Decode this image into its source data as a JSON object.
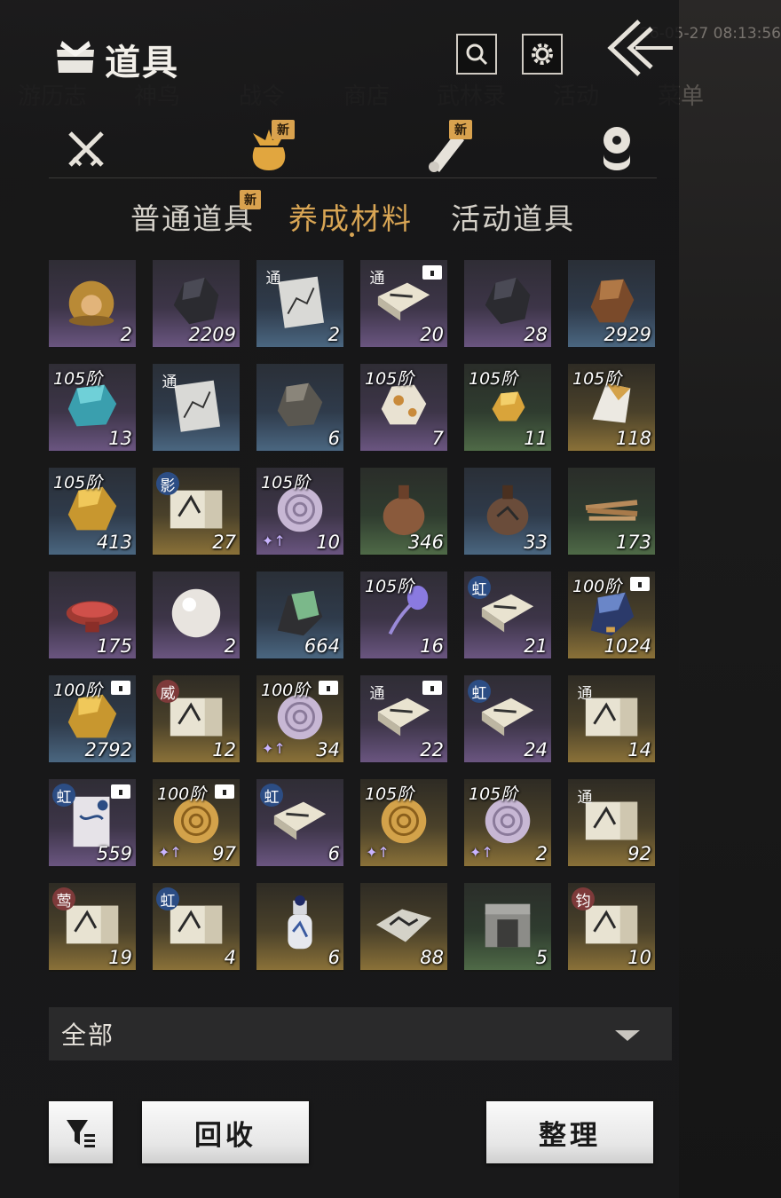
{
  "background": {
    "nav_labels": [
      "游历志",
      "神鸟",
      "战令",
      "商店",
      "武林录",
      "活动",
      "菜单"
    ],
    "clock": "26-05-27 08:13:56"
  },
  "header": {
    "title": "道具",
    "title_icon": "bundle-icon",
    "search_icon": "search-icon",
    "settings_icon": "gear-icon",
    "back_icon": "back-chevron-icon"
  },
  "category_tabs": [
    {
      "icon": "crossed-swords-icon",
      "badge": ""
    },
    {
      "icon": "pouch-icon",
      "badge": "新",
      "active": true
    },
    {
      "icon": "scroll-icon",
      "badge": "新"
    },
    {
      "icon": "stacked-coins-icon",
      "badge": ""
    }
  ],
  "sub_tabs": [
    {
      "label": "普通道具",
      "badge": "新"
    },
    {
      "label": "养成材料",
      "active": true
    },
    {
      "label": "活动道具"
    }
  ],
  "items": [
    {
      "art": "golden-orb",
      "rarity": "purple",
      "count": "2"
    },
    {
      "art": "dark-ore",
      "rarity": "purple",
      "count": "2209"
    },
    {
      "art": "chart-manual",
      "rarity": "blue",
      "count": "2",
      "tag": "通"
    },
    {
      "art": "manual-book",
      "rarity": "purple",
      "count": "20",
      "tag": "通",
      "lock": true
    },
    {
      "art": "dark-ore",
      "rarity": "purple",
      "count": "28"
    },
    {
      "art": "copper-ore",
      "rarity": "blue",
      "count": "2929"
    },
    {
      "art": "turquoise-ore",
      "rarity": "purple",
      "count": "13",
      "tier": "105阶"
    },
    {
      "art": "chart-manual",
      "rarity": "blue",
      "count": "",
      "tag": "通"
    },
    {
      "art": "grey-ore",
      "rarity": "blue",
      "count": "6"
    },
    {
      "art": "white-gold-ore",
      "rarity": "purple",
      "count": "7",
      "tier": "105阶"
    },
    {
      "art": "gold-nugget",
      "rarity": "green",
      "count": "11",
      "tier": "105阶"
    },
    {
      "art": "white-crystal",
      "rarity": "gold",
      "count": "118",
      "tier": "105阶"
    },
    {
      "art": "gold-nugget-large",
      "rarity": "blue",
      "count": "413",
      "tier": "105阶"
    },
    {
      "art": "skill-scroll",
      "rarity": "gold",
      "count": "27",
      "tag": "影"
    },
    {
      "art": "conch-shell",
      "rarity": "purple",
      "count": "10",
      "tier": "105阶",
      "up": true
    },
    {
      "art": "gourd-flask",
      "rarity": "green",
      "count": "346"
    },
    {
      "art": "gourd-flask-dark",
      "rarity": "blue",
      "count": "33"
    },
    {
      "art": "wood-bundle",
      "rarity": "green",
      "count": "173"
    },
    {
      "art": "red-dish",
      "rarity": "purple",
      "count": "175"
    },
    {
      "art": "pearl",
      "rarity": "purple",
      "count": "2"
    },
    {
      "art": "jade-ore",
      "rarity": "blue",
      "count": "664"
    },
    {
      "art": "violet-flower",
      "rarity": "purple",
      "count": "16",
      "tier": "105阶"
    },
    {
      "art": "manual-book",
      "rarity": "purple",
      "count": "21",
      "tag": "虹"
    },
    {
      "art": "blue-crystal",
      "rarity": "gold",
      "count": "1024",
      "tier": "100阶",
      "lock": true
    },
    {
      "art": "gold-nugget-large",
      "rarity": "blue",
      "count": "2792",
      "tier": "100阶",
      "lock": true
    },
    {
      "art": "skill-scroll",
      "rarity": "gold",
      "count": "12",
      "tag": "威"
    },
    {
      "art": "conch-shell",
      "rarity": "gold",
      "count": "34",
      "tier": "100阶",
      "lock": true,
      "up": true
    },
    {
      "art": "manual-book",
      "rarity": "purple",
      "count": "22",
      "tag": "通",
      "lock": true
    },
    {
      "art": "manual-book",
      "rarity": "purple",
      "count": "24",
      "tag": "虹"
    },
    {
      "art": "skill-scroll",
      "rarity": "gold",
      "count": "14",
      "tag": "通"
    },
    {
      "art": "letter",
      "rarity": "purple",
      "count": "559",
      "tag": "虹",
      "lock": true
    },
    {
      "art": "golden-conch",
      "rarity": "gold",
      "count": "97",
      "tier": "100阶",
      "lock": true,
      "up": true
    },
    {
      "art": "manual-book",
      "rarity": "purple",
      "count": "6",
      "tag": "虹"
    },
    {
      "art": "golden-conch",
      "rarity": "gold",
      "count": "",
      "tier": "105阶",
      "up": true
    },
    {
      "art": "conch-shell",
      "rarity": "gold",
      "count": "2",
      "tier": "105阶",
      "up": true
    },
    {
      "art": "skill-scroll",
      "rarity": "gold",
      "count": "92",
      "tag": "通"
    },
    {
      "art": "skill-scroll",
      "rarity": "gold",
      "count": "19",
      "tag": "莺"
    },
    {
      "art": "skill-scroll",
      "rarity": "gold",
      "count": "4",
      "tag": "虹"
    },
    {
      "art": "porcelain-bottle",
      "rarity": "gold",
      "count": "6"
    },
    {
      "art": "map",
      "rarity": "gold",
      "count": "88"
    },
    {
      "art": "stone-block",
      "rarity": "green",
      "count": "5"
    },
    {
      "art": "skill-scroll",
      "rarity": "gold",
      "count": "10",
      "tag": "钧"
    }
  ],
  "filter": {
    "selected": "全部"
  },
  "buttons": {
    "filter_icon": "filter-icon",
    "recycle": "回收",
    "sort": "整理"
  },
  "colors": {
    "accent": "#d8a554",
    "badge": "#d9a24e",
    "panel": "#19191a"
  }
}
